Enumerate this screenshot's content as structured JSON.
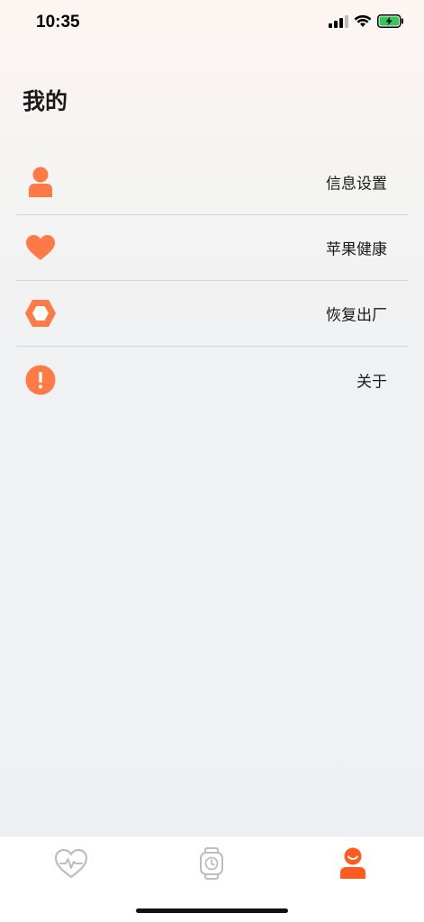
{
  "status_bar": {
    "time": "10:35"
  },
  "page": {
    "title": "我的"
  },
  "menu": {
    "items": [
      {
        "label": "信息设置",
        "icon": "user-icon"
      },
      {
        "label": "苹果健康",
        "icon": "heart-icon"
      },
      {
        "label": "恢复出厂",
        "icon": "hexagon-nut-icon"
      },
      {
        "label": "关于",
        "icon": "exclamation-icon"
      }
    ]
  },
  "tab_bar": {
    "tabs": [
      {
        "icon": "heart-pulse-icon",
        "active": false
      },
      {
        "icon": "watch-icon",
        "active": false
      },
      {
        "icon": "profile-icon",
        "active": true
      }
    ]
  },
  "colors": {
    "accent": "#FF7A45",
    "active_tab": "#FF5A1F",
    "inactive_tab": "#BDBDBD",
    "battery": "#34C759"
  }
}
